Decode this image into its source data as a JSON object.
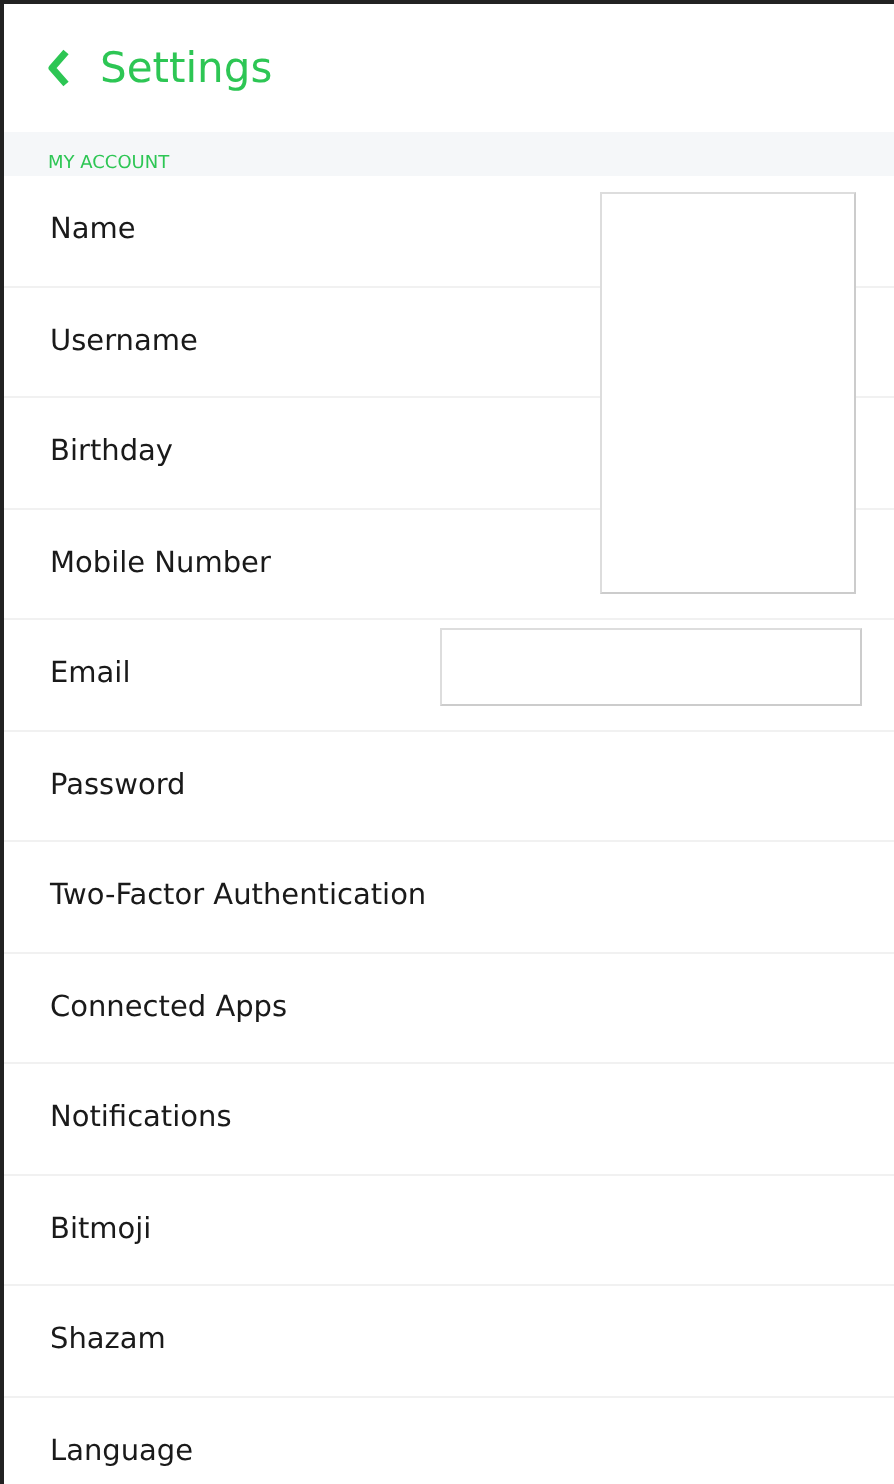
{
  "header": {
    "title": "Settings"
  },
  "section": {
    "title": "MY ACCOUNT"
  },
  "items": [
    "Name",
    "Username",
    "Birthday",
    "Mobile Number",
    "Email",
    "Password",
    "Two-Factor Authentication",
    "Connected Apps",
    "Notifications",
    "Bitmoji",
    "Shazam",
    "Language"
  ]
}
